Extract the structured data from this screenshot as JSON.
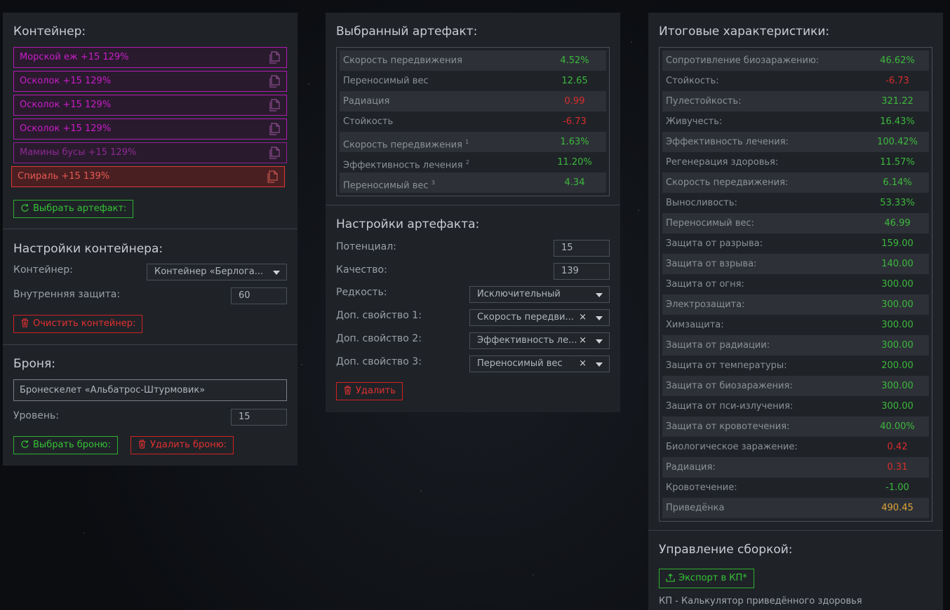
{
  "container_panel": {
    "title": "Контейнер:",
    "artifacts": [
      {
        "label": "Морской еж +15 129%",
        "state": "normal"
      },
      {
        "label": "Осколок +15 129%",
        "state": "normal"
      },
      {
        "label": "Осколок +15 129%",
        "state": "normal"
      },
      {
        "label": "Осколок +15 129%",
        "state": "normal"
      },
      {
        "label": "Мамины бусы +15 129%",
        "state": "faded"
      },
      {
        "label": "Спираль +15 139%",
        "state": "active"
      }
    ],
    "copy_icon": "copy-icon",
    "select_artifact_btn": "Выбрать артефакт:",
    "settings_title": "Настройки контейнера:",
    "container_label": "Контейнер:",
    "container_value": "Контейнер «Берлога...",
    "inner_protection_label": "Внутренняя защита:",
    "inner_protection_value": "60",
    "clear_btn": "Очистить контейнер:",
    "armor_title": "Броня:",
    "armor_value": "Бронескелет «Альбатрос-Штурмовик»",
    "level_label": "Уровень:",
    "level_value": "15",
    "select_armor_btn": "Выбрать броню:",
    "delete_armor_btn": "Удалить броню:"
  },
  "selected_artifact": {
    "title": "Выбранный артефакт:",
    "stats": [
      {
        "name": "Скорость передвижения",
        "sup": "",
        "value": "4.52%",
        "tone": "pos"
      },
      {
        "name": "Переносимый вес",
        "sup": "",
        "value": "12.65",
        "tone": "pos"
      },
      {
        "name": "Радиация",
        "sup": "",
        "value": "0.99",
        "tone": "neg"
      },
      {
        "name": "Стойкость",
        "sup": "",
        "value": "-6.73",
        "tone": "neg"
      },
      {
        "name": "Скорость передвижения",
        "sup": "1",
        "value": "1.63%",
        "tone": "pos"
      },
      {
        "name": "Эффективность лечения",
        "sup": "2",
        "value": "11.20%",
        "tone": "pos"
      },
      {
        "name": "Переносимый вес",
        "sup": "3",
        "value": "4.34",
        "tone": "pos"
      }
    ],
    "settings_title": "Настройки артефакта:",
    "potential_label": "Потенциал:",
    "potential_value": "15",
    "quality_label": "Качество:",
    "quality_value": "139",
    "rarity_label": "Редкость:",
    "rarity_value": "Исключительный",
    "extra1_label": "Доп. свойство 1:",
    "extra1_value": "Скорость передви...",
    "extra2_label": "Доп. свойство 2:",
    "extra2_value": "Эффективность ле...",
    "extra3_label": "Доп. свойство 3:",
    "extra3_value": "Переносимый вес",
    "clear_x": "×",
    "delete_btn": "Удалить"
  },
  "totals": {
    "title": "Итоговые характеристики:",
    "stats": [
      {
        "name": "Сопротивление биозаражению:",
        "value": "46.62%",
        "tone": "pos"
      },
      {
        "name": "Стойкость:",
        "value": "-6.73",
        "tone": "neg"
      },
      {
        "name": "Пулестойкость:",
        "value": "321.22",
        "tone": "pos"
      },
      {
        "name": "Живучесть:",
        "value": "16.43%",
        "tone": "pos"
      },
      {
        "name": "Эффективность лечения:",
        "value": "100.42%",
        "tone": "pos"
      },
      {
        "name": "Регенерация здоровья:",
        "value": "11.57%",
        "tone": "pos"
      },
      {
        "name": "Скорость передвижения:",
        "value": "6.14%",
        "tone": "pos"
      },
      {
        "name": "Выносливость:",
        "value": "53.33%",
        "tone": "pos"
      },
      {
        "name": "Переносимый вес:",
        "value": "46.99",
        "tone": "pos"
      },
      {
        "name": "Защита от разрыва:",
        "value": "159.00",
        "tone": "pos"
      },
      {
        "name": "Защита от взрыва:",
        "value": "140.00",
        "tone": "pos"
      },
      {
        "name": "Защита от огня:",
        "value": "300.00",
        "tone": "pos"
      },
      {
        "name": "Электрозащита:",
        "value": "300.00",
        "tone": "pos"
      },
      {
        "name": "Химзащита:",
        "value": "300.00",
        "tone": "pos"
      },
      {
        "name": "Защита от радиации:",
        "value": "300.00",
        "tone": "pos"
      },
      {
        "name": "Защита от температуры:",
        "value": "200.00",
        "tone": "pos"
      },
      {
        "name": "Защита от биозаражения:",
        "value": "300.00",
        "tone": "pos"
      },
      {
        "name": "Защита от пси-излучения:",
        "value": "300.00",
        "tone": "pos"
      },
      {
        "name": "Защита от кровотечения:",
        "value": "40.00%",
        "tone": "pos"
      },
      {
        "name": "Биологическое заражение:",
        "value": "0.42",
        "tone": "neg"
      },
      {
        "name": "Радиация:",
        "value": "0.31",
        "tone": "neg"
      },
      {
        "name": "Кровотечение:",
        "value": "-1.00",
        "tone": "pos"
      },
      {
        "name": "Приведёнка",
        "value": "490.45",
        "tone": "gold"
      }
    ],
    "build_title": "Управление сборкой:",
    "export_btn": "Экспорт в КП*",
    "footnote": "КП - Калькулятор приведённого здоровья"
  },
  "colors": {
    "positive": "#3db83d",
    "negative": "#d92c2c",
    "highlight": "#e0a43a",
    "artifact_border": "#b21ab2",
    "active_artifact": "#e03636"
  }
}
